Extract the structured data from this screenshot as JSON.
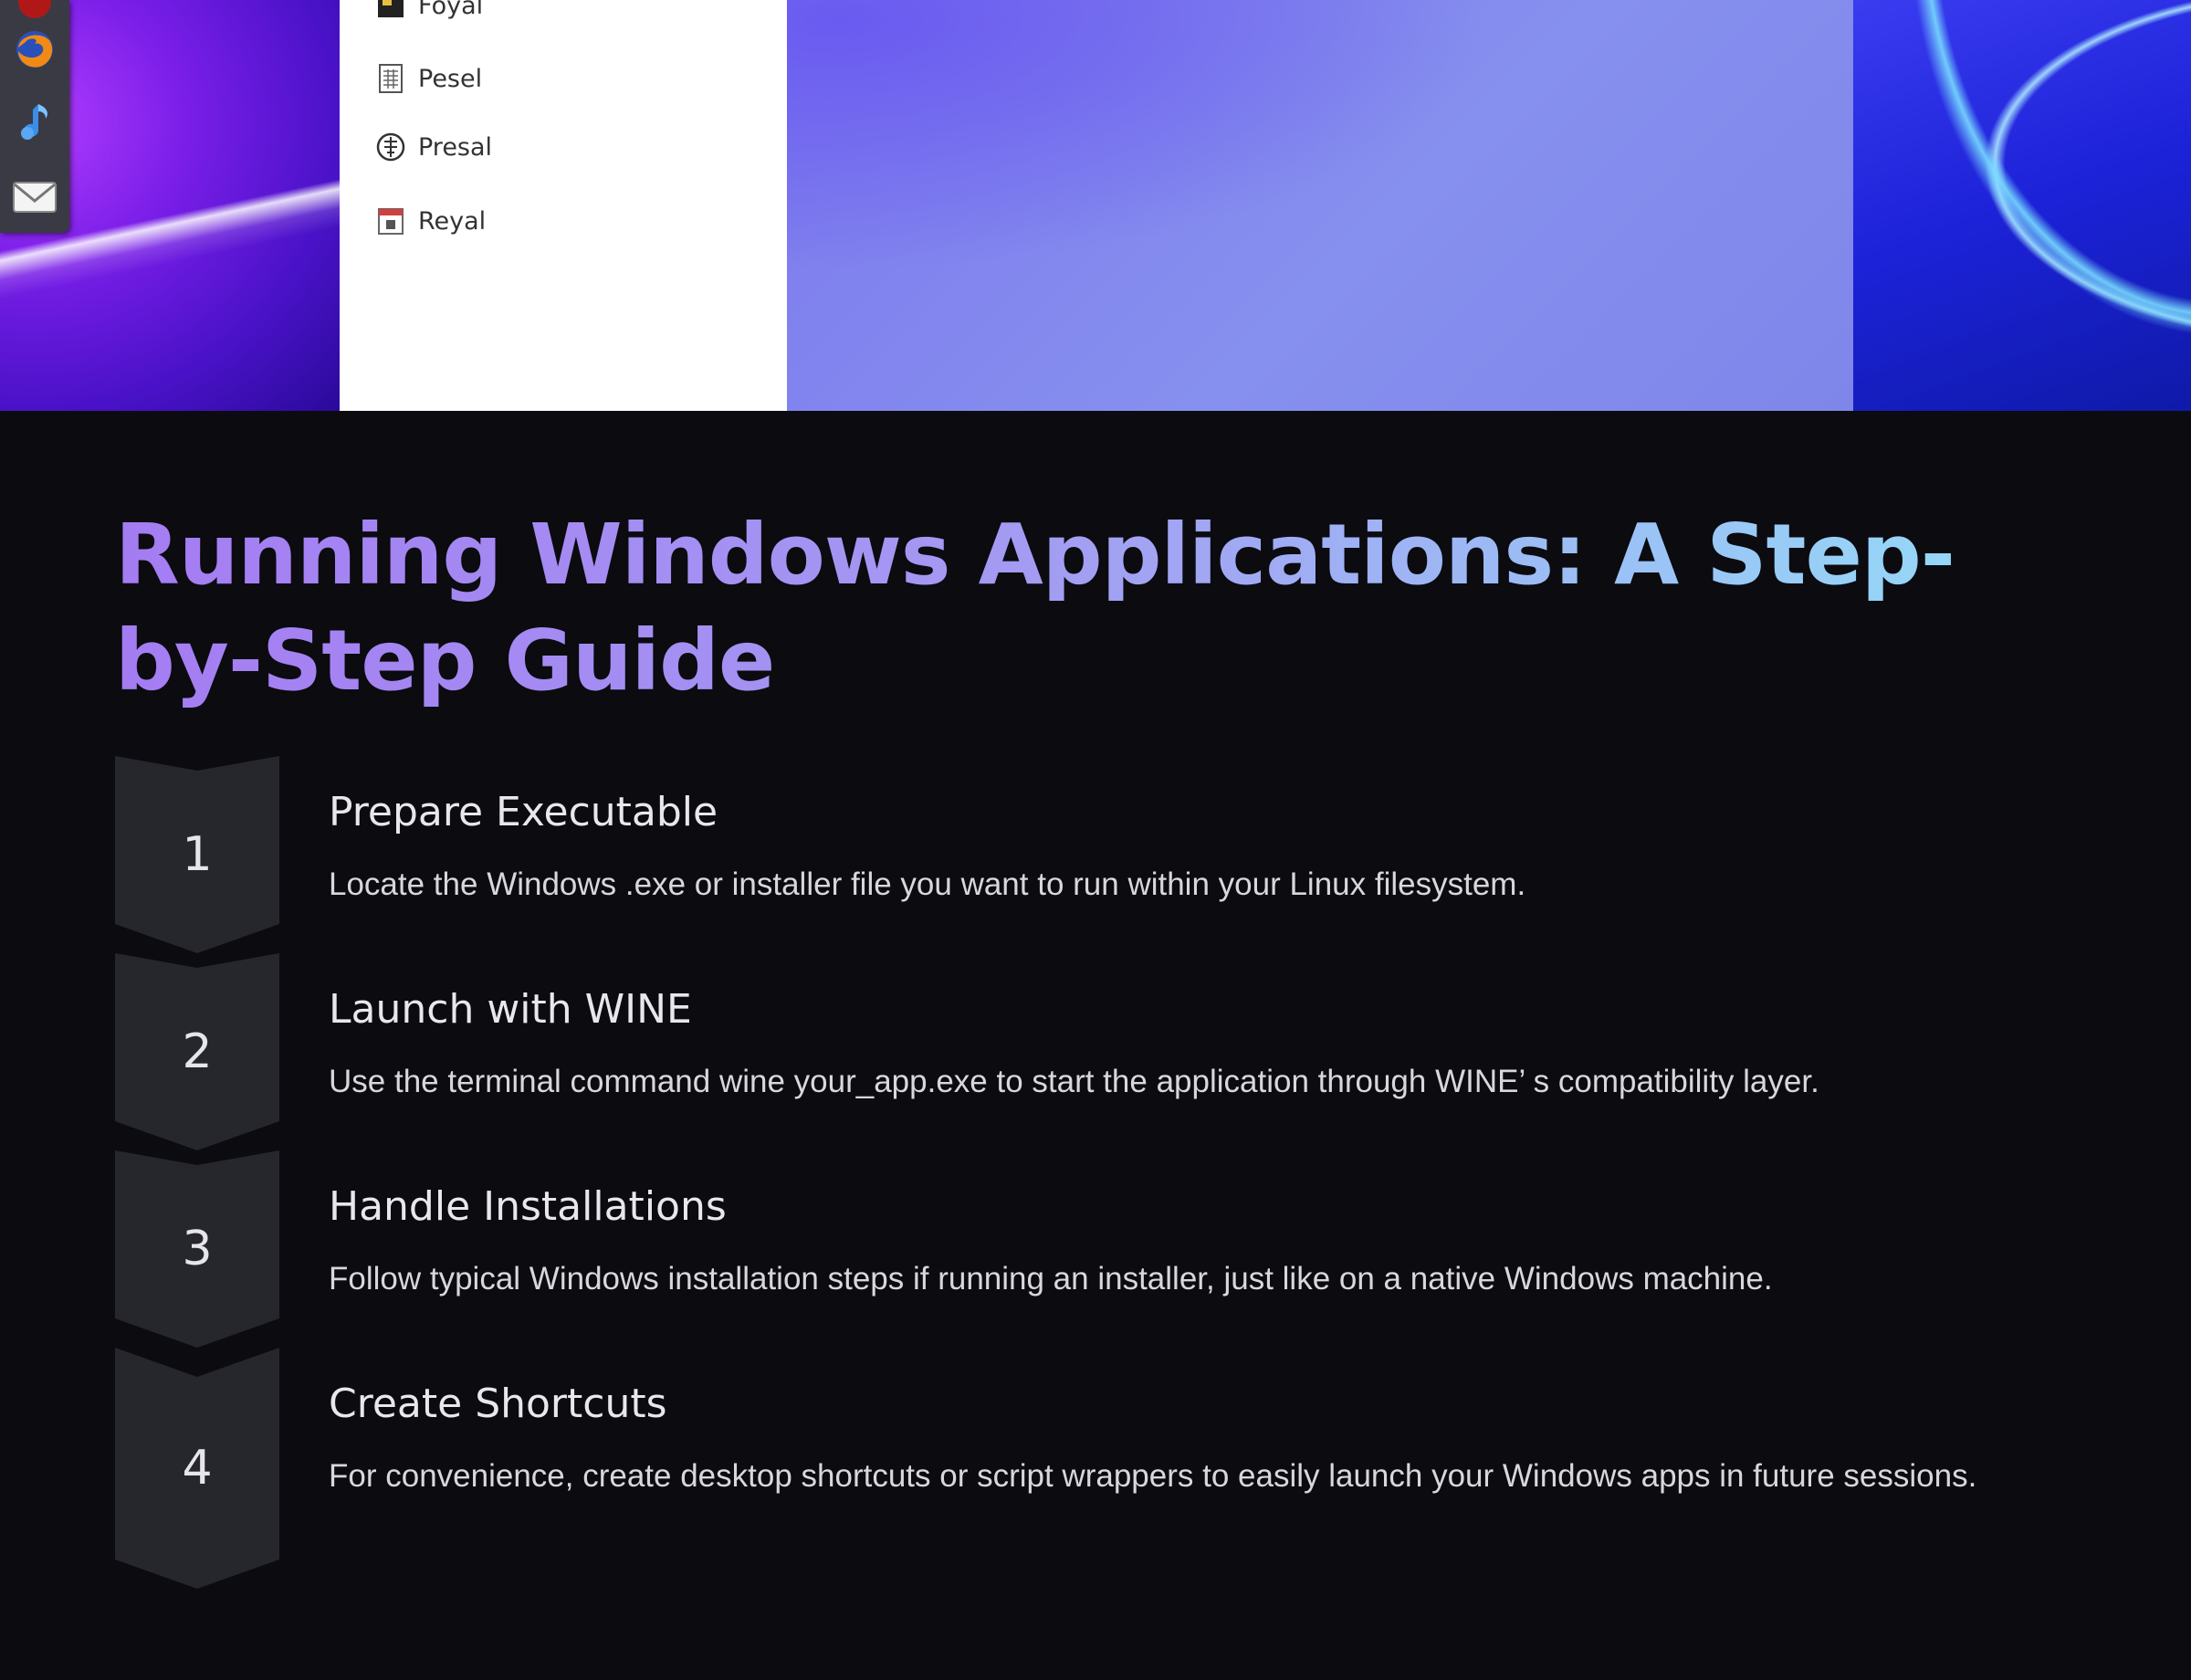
{
  "screenshot": {
    "dock_icons": [
      "firefox-icon",
      "music-note-icon",
      "mail-icon"
    ],
    "file_items": [
      {
        "label": "Foyal",
        "icon": "image-icon"
      },
      {
        "label": "Pesel",
        "icon": "document-grid-icon"
      },
      {
        "label": "Presal",
        "icon": "globe-icon"
      },
      {
        "label": "Reyal",
        "icon": "calendar-icon"
      }
    ]
  },
  "guide": {
    "title": "Running Windows Applications: A Step-by-Step Guide",
    "steps": [
      {
        "number": "1",
        "title": "Prepare Executable",
        "description": "Locate the Windows .exe or installer file you want to run within your Linux filesystem."
      },
      {
        "number": "2",
        "title": "Launch with WINE",
        "description": "Use the terminal command wine your_app.exe to start the application through WINE’  s compatibility layer."
      },
      {
        "number": "3",
        "title": "Handle Installations",
        "description": "Follow typical Windows installation steps if running an installer, just like on a native Windows machine."
      },
      {
        "number": "4",
        "title": "Create Shortcuts",
        "description": "For convenience, create desktop shortcuts or script wrappers to easily launch your Windows apps in future sessions."
      }
    ]
  },
  "colors": {
    "background": "#0b0b10",
    "chevron": "#26262d",
    "title_gradient_start": "#a47cf2",
    "title_gradient_end": "#94dff8"
  }
}
